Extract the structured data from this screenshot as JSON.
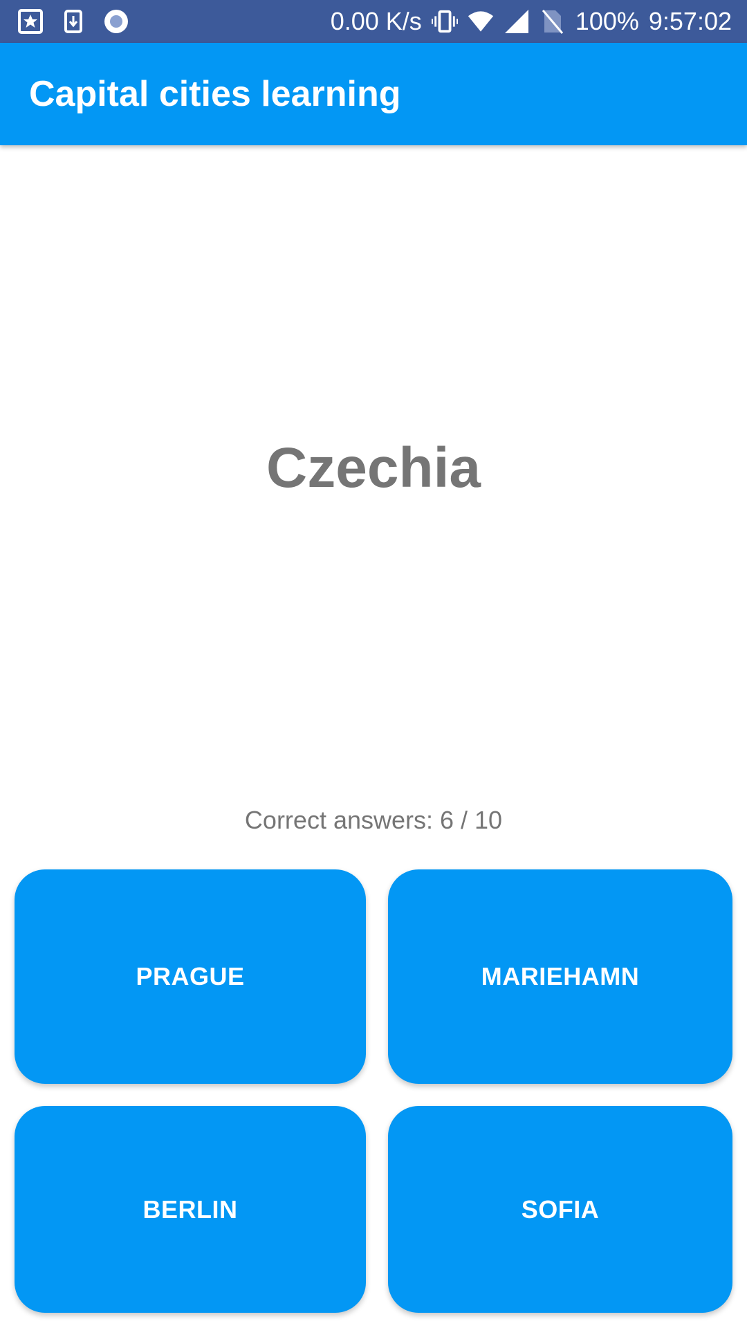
{
  "status_bar": {
    "icons_left": [
      "star-notification-icon",
      "download-notification-icon",
      "record-indicator-icon"
    ],
    "net_speed": "0.00 K/s",
    "icons_right": [
      "vibrate-icon",
      "wifi-icon",
      "cell-signal-icon",
      "no-sim-icon"
    ],
    "battery": "100%",
    "time": "9:57:02"
  },
  "app_bar": {
    "title": "Capital cities learning"
  },
  "question": {
    "country": "Czechia"
  },
  "score": {
    "text": "Correct answers: 6 / 10"
  },
  "answers": [
    {
      "label": "PRAGUE"
    },
    {
      "label": "MARIEHAMN"
    },
    {
      "label": "BERLIN"
    },
    {
      "label": "SOFIA"
    }
  ],
  "colors": {
    "status_bar": "#3d5a9a",
    "primary": "#0397f4",
    "text_gray": "#757575",
    "background": "#ffffff"
  }
}
